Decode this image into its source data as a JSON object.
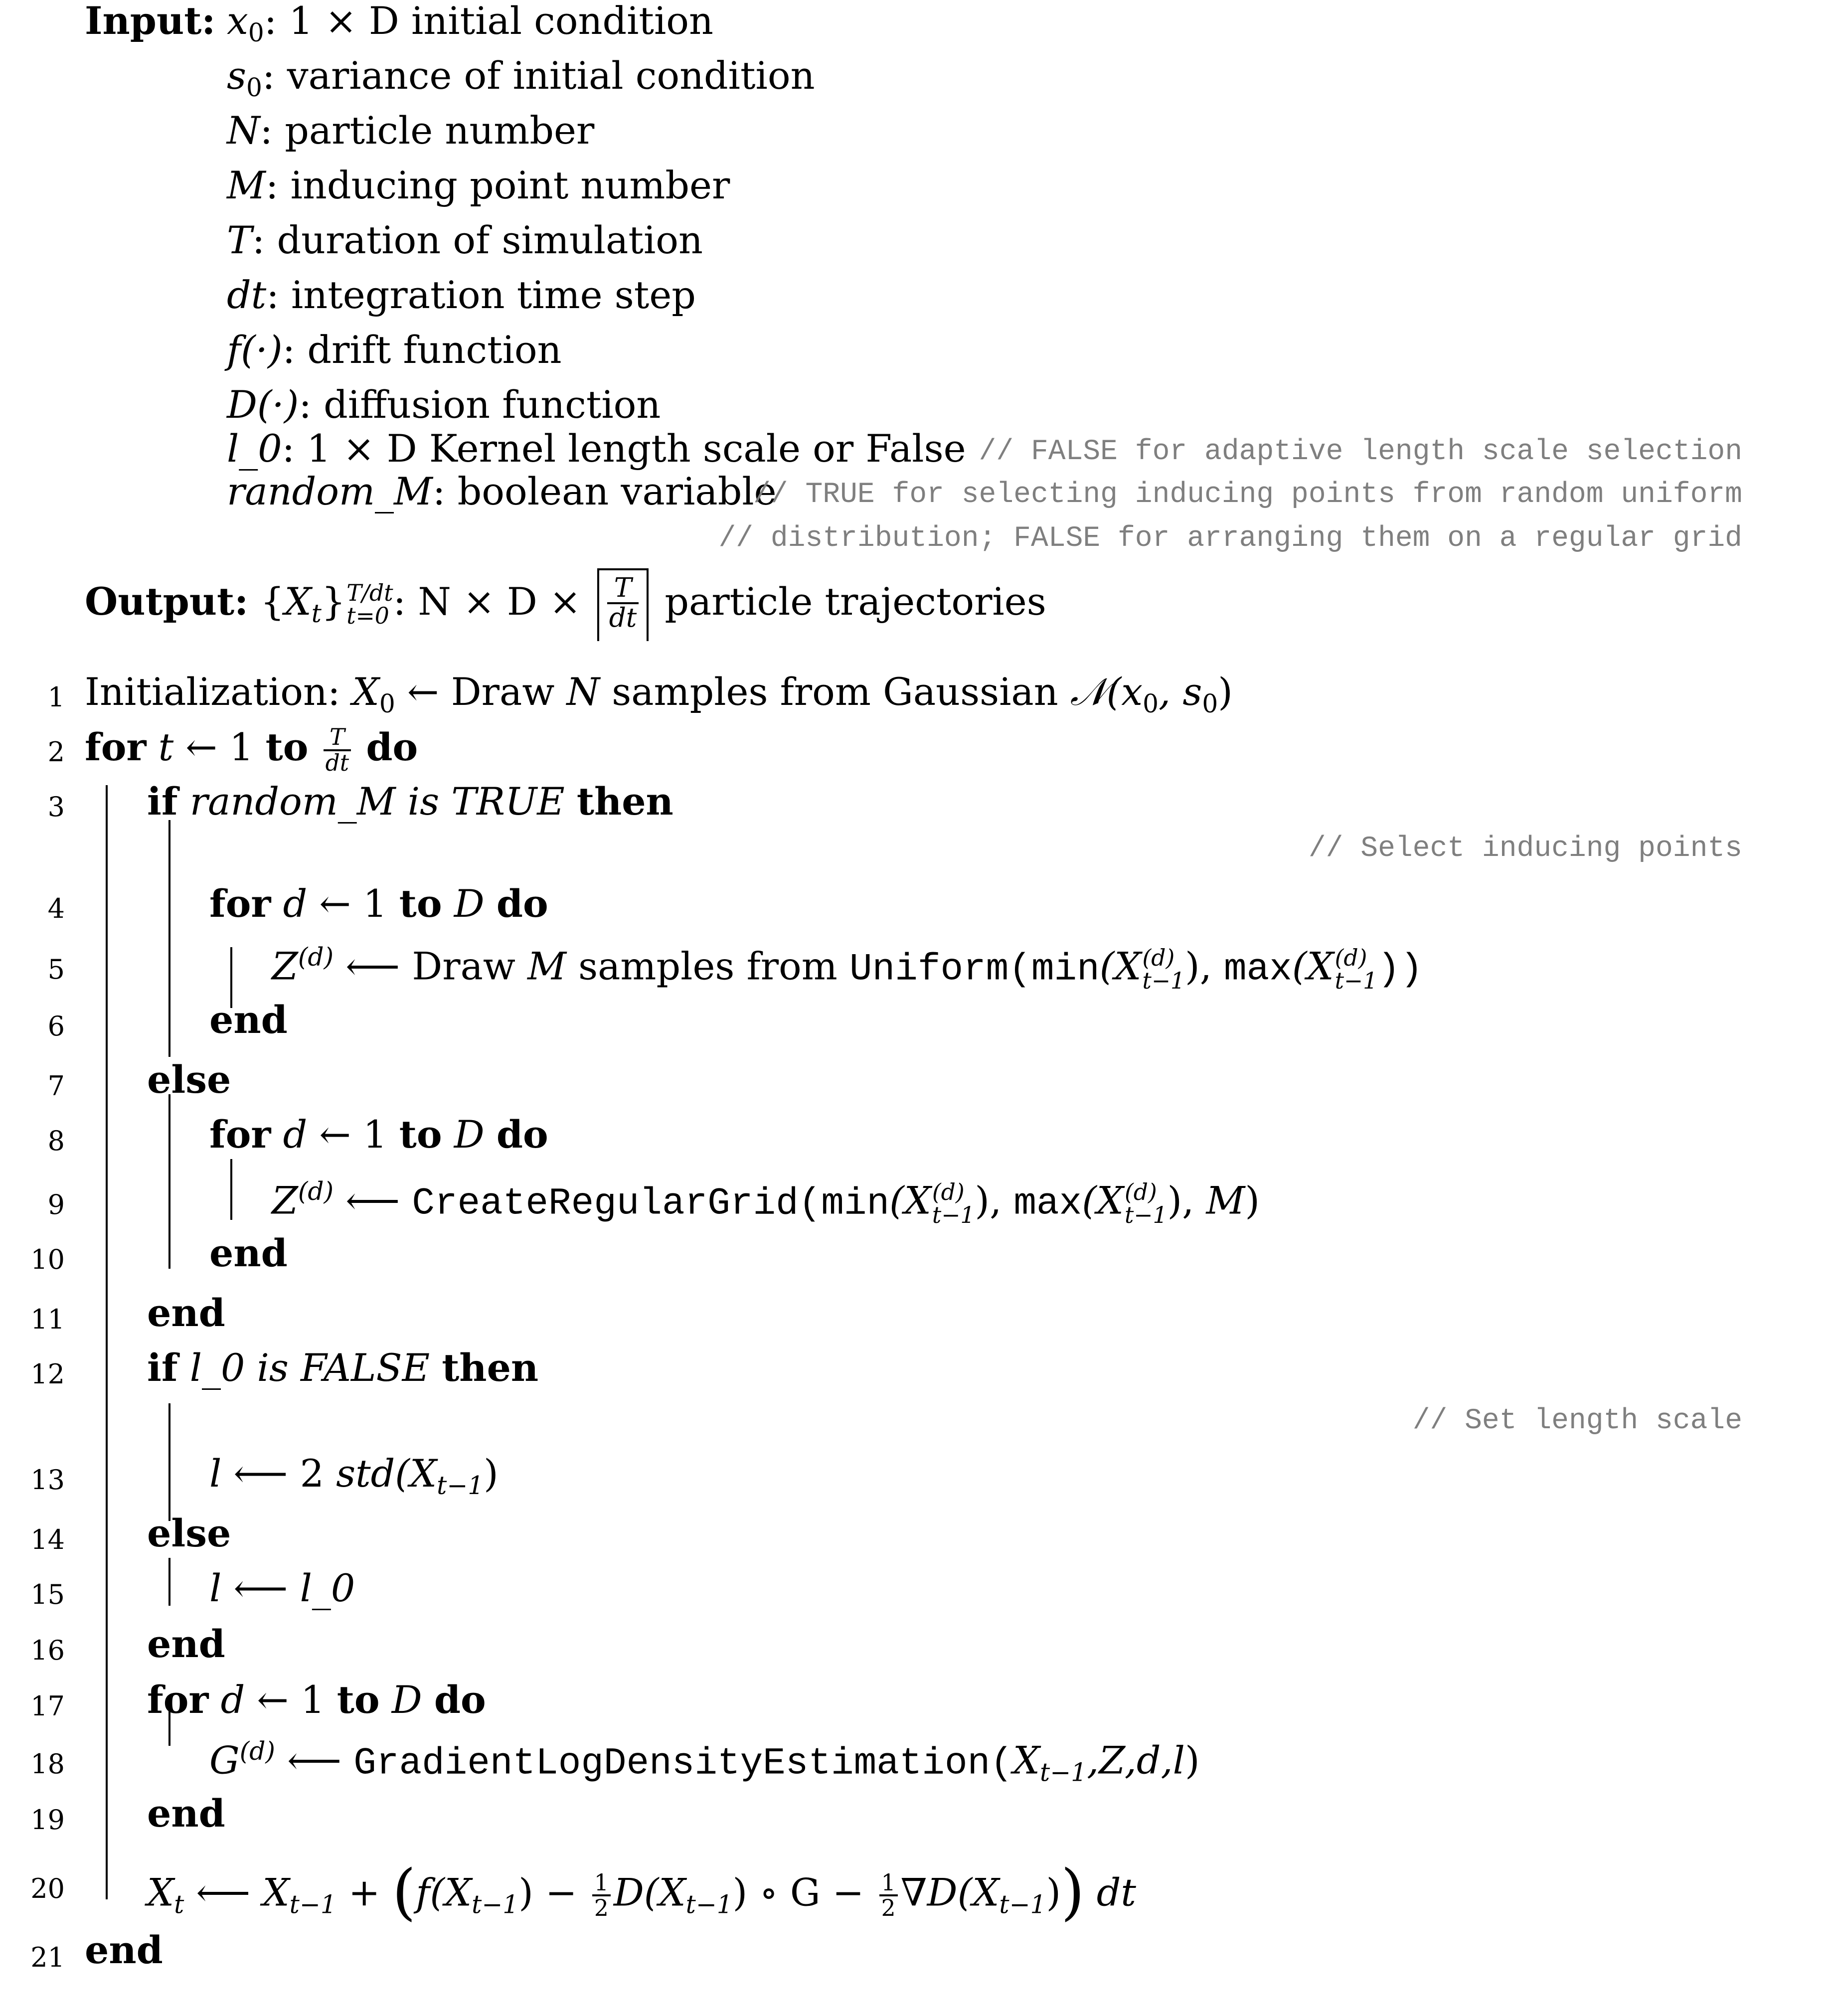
{
  "input": {
    "label": "Input:",
    "items": [
      {
        "sym": "x",
        "sub": "0",
        "desc": ": 1 × D initial condition"
      },
      {
        "sym": "s",
        "sub": "0",
        "desc": ": variance of initial condition"
      },
      {
        "sym": "N",
        "desc": ": particle number"
      },
      {
        "sym": "M",
        "desc": ": inducing point number"
      },
      {
        "sym": "T",
        "desc": ": duration of simulation"
      },
      {
        "sym": "dt",
        "desc": ": integration time step"
      },
      {
        "sym": "f(·)",
        "desc": ": drift function"
      },
      {
        "sym": "D(·)",
        "desc": ": diffusion function"
      },
      {
        "sym": "l_0",
        "desc": ": 1 × D Kernel length scale or False",
        "comment": "// FALSE for adaptive length scale selection"
      },
      {
        "sym": "random_M",
        "desc": ": boolean variable",
        "comment": "// TRUE for selecting inducing points from random uniform",
        "comment2": "// distribution; FALSE for arranging them on a regular grid"
      }
    ]
  },
  "output": {
    "label": "Output:",
    "set_sym": "X",
    "set_sub": "t",
    "upper": "T/dt",
    "lower": "t=0",
    "dims": ": N × D ×",
    "frac_num": "T",
    "frac_den": "dt",
    "desc": "particle trajectories"
  },
  "lines": [
    {
      "n": "1",
      "parts": {
        "a": "Initialization: ",
        "b": "X",
        "b_sub": "0",
        "c": " ← Draw ",
        "d": "N",
        "e": " samples from Gaussian ",
        "f": "𝒩",
        "g": "(x",
        "g_sub": "0",
        "h": ", s",
        "h_sub": "0",
        "i": ")"
      }
    },
    {
      "n": "2",
      "parts": {
        "kw1": "for",
        "v": " t",
        "arrow": " ← 1 ",
        "kw2": "to",
        "num": "T",
        "den": "dt",
        "kw3": "do"
      }
    },
    {
      "n": "3",
      "parts": {
        "kw1": "if",
        "cond": " random_M  is TRUE ",
        "kw2": "then"
      }
    },
    {
      "n": "",
      "comment": "// Select inducing points"
    },
    {
      "n": "4",
      "parts": {
        "kw1": "for",
        "v": " d",
        "arrow": " ← 1 ",
        "kw2": "to",
        "D": " D ",
        "kw3": "do"
      }
    },
    {
      "n": "5",
      "parts": {
        "lhs": "Z",
        "lhs_sup": "(d)",
        "arrow": " ⟵ Draw ",
        "m": "M",
        "rest": " samples from ",
        "fn": "Uniform",
        "open": "(",
        "min": "min",
        "x1": "(X",
        "sup": "(d)",
        "sub": "t−1",
        "close1": "), ",
        "max": "max",
        "x2": "(X",
        "close2": "))"
      }
    },
    {
      "n": "6",
      "kw": "end"
    },
    {
      "n": "7",
      "kw": "else"
    },
    {
      "n": "8",
      "parts": {
        "kw1": "for",
        "v": " d",
        "arrow": " ← 1 ",
        "kw2": "to",
        "D": " D ",
        "kw3": "do"
      }
    },
    {
      "n": "9",
      "parts": {
        "lhs": "Z",
        "lhs_sup": "(d)",
        "arrow": " ⟵ ",
        "fn": "CreateRegularGrid",
        "open": "(",
        "min": "min",
        "x1": "(X",
        "sup": "(d)",
        "sub": "t−1",
        "close1": "), ",
        "max": "max",
        "x2": "(X",
        "close2": "), ",
        "m": "M",
        "close3": ")"
      }
    },
    {
      "n": "10",
      "kw": "end"
    },
    {
      "n": "11",
      "kw": "end"
    },
    {
      "n": "12",
      "parts": {
        "kw1": "if",
        "cond": " l_0  is FALSE ",
        "kw2": "then"
      }
    },
    {
      "n": "",
      "comment": "// Set length scale"
    },
    {
      "n": "13",
      "parts": {
        "l": "l",
        "arrow": " ⟵ 2 ",
        "std": "std",
        "x": "(X",
        "sub": "t−1",
        "close": ")"
      }
    },
    {
      "n": "14",
      "kw": "else"
    },
    {
      "n": "15",
      "parts": {
        "l": "l",
        "arrow": " ⟵ ",
        "rhs": "l_0"
      }
    },
    {
      "n": "16",
      "kw": "end"
    },
    {
      "n": "17",
      "parts": {
        "kw1": "for",
        "v": " d",
        "arrow": " ← 1 ",
        "kw2": "to",
        "D": " D ",
        "kw3": "do"
      }
    },
    {
      "n": "18",
      "parts": {
        "lhs": "G",
        "lhs_sup": "(d)",
        "arrow": " ⟵ ",
        "fn": "GradientLogDensityEstimation",
        "open": "(",
        "args": "X",
        "sub": "t−1",
        "rest": ",Z,d,l",
        "close": ")"
      }
    },
    {
      "n": "19",
      "kw": "end"
    },
    {
      "n": "20",
      "parts": {
        "lhs": "X",
        "lhs_sub": "t",
        "arrow": " ⟵ X",
        "sub1": "t−1",
        "plus": " + ",
        "lp": "(",
        "f": "f",
        "fx": "(X",
        "sub2": "t−1",
        "c1": ") − ",
        "half_num": "1",
        "half_den": "2",
        "Dx": "D(X",
        "sub3": "t−1",
        "c2": ") ∘ G − ",
        "nab": "∇D(X",
        "sub4": "t−1",
        "c3": ")",
        "rp": ")",
        "dt": " dt"
      }
    },
    {
      "n": "21",
      "kw": "end"
    }
  ]
}
